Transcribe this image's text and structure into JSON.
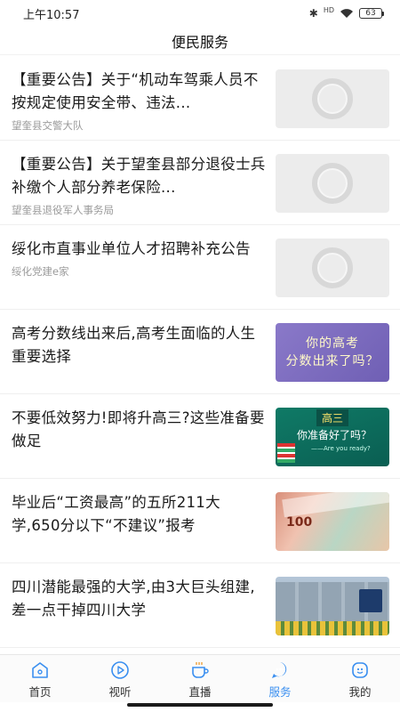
{
  "status_bar": {
    "time": "上午10:57",
    "network_label": "HD",
    "battery": "63"
  },
  "header": {
    "title": "便民服务"
  },
  "news": [
    {
      "title": "【重要公告】关于“机动车驾乘人员不按规定使用安全带、违法...",
      "source": "望奎县交警大队",
      "thumb": "loading-placeholder"
    },
    {
      "title": "【重要公告】关于望奎县部分退役士兵 补缴个人部分养老保险...",
      "source": "望奎县退役军人事务局",
      "thumb": "loading-placeholder"
    },
    {
      "title": "绥化市直事业单位人才招聘补充公告",
      "source": "绥化党建e家",
      "thumb": "loading-placeholder"
    },
    {
      "title": "高考分数线出来后,高考生面临的人生重要选择",
      "source": "",
      "thumb": "purple-banner",
      "thumb_text_1": "你的高考",
      "thumb_text_2": "分数出来了吗？"
    },
    {
      "title": "不要低效努力!即将升高三?这些准备要做足",
      "source": "",
      "thumb": "green-board",
      "thumb_head": "高三",
      "thumb_main": "你准备好了吗？",
      "thumb_sub": "——Are you ready?"
    },
    {
      "title": "毕业后“工资最高”的五所211大学,650分以下“不建议”报考",
      "source": "",
      "thumb": "money-photo",
      "thumb_text": "100"
    },
    {
      "title": "四川潜能最强的大学,由3大巨头组建,差一点干掉四川大学",
      "source": "",
      "thumb": "campus-photo"
    }
  ],
  "tabs": [
    {
      "label": "首页",
      "icon": "home-icon",
      "active": false
    },
    {
      "label": "视听",
      "icon": "play-icon",
      "active": false
    },
    {
      "label": "直播",
      "icon": "live-cup-icon",
      "active": false
    },
    {
      "label": "服务",
      "icon": "service-icon",
      "active": true
    },
    {
      "label": "我的",
      "icon": "profile-icon",
      "active": false
    }
  ],
  "colors": {
    "accent": "#3a8ff0",
    "text": "#1a1a1a",
    "source_text": "#9a9a9a"
  }
}
